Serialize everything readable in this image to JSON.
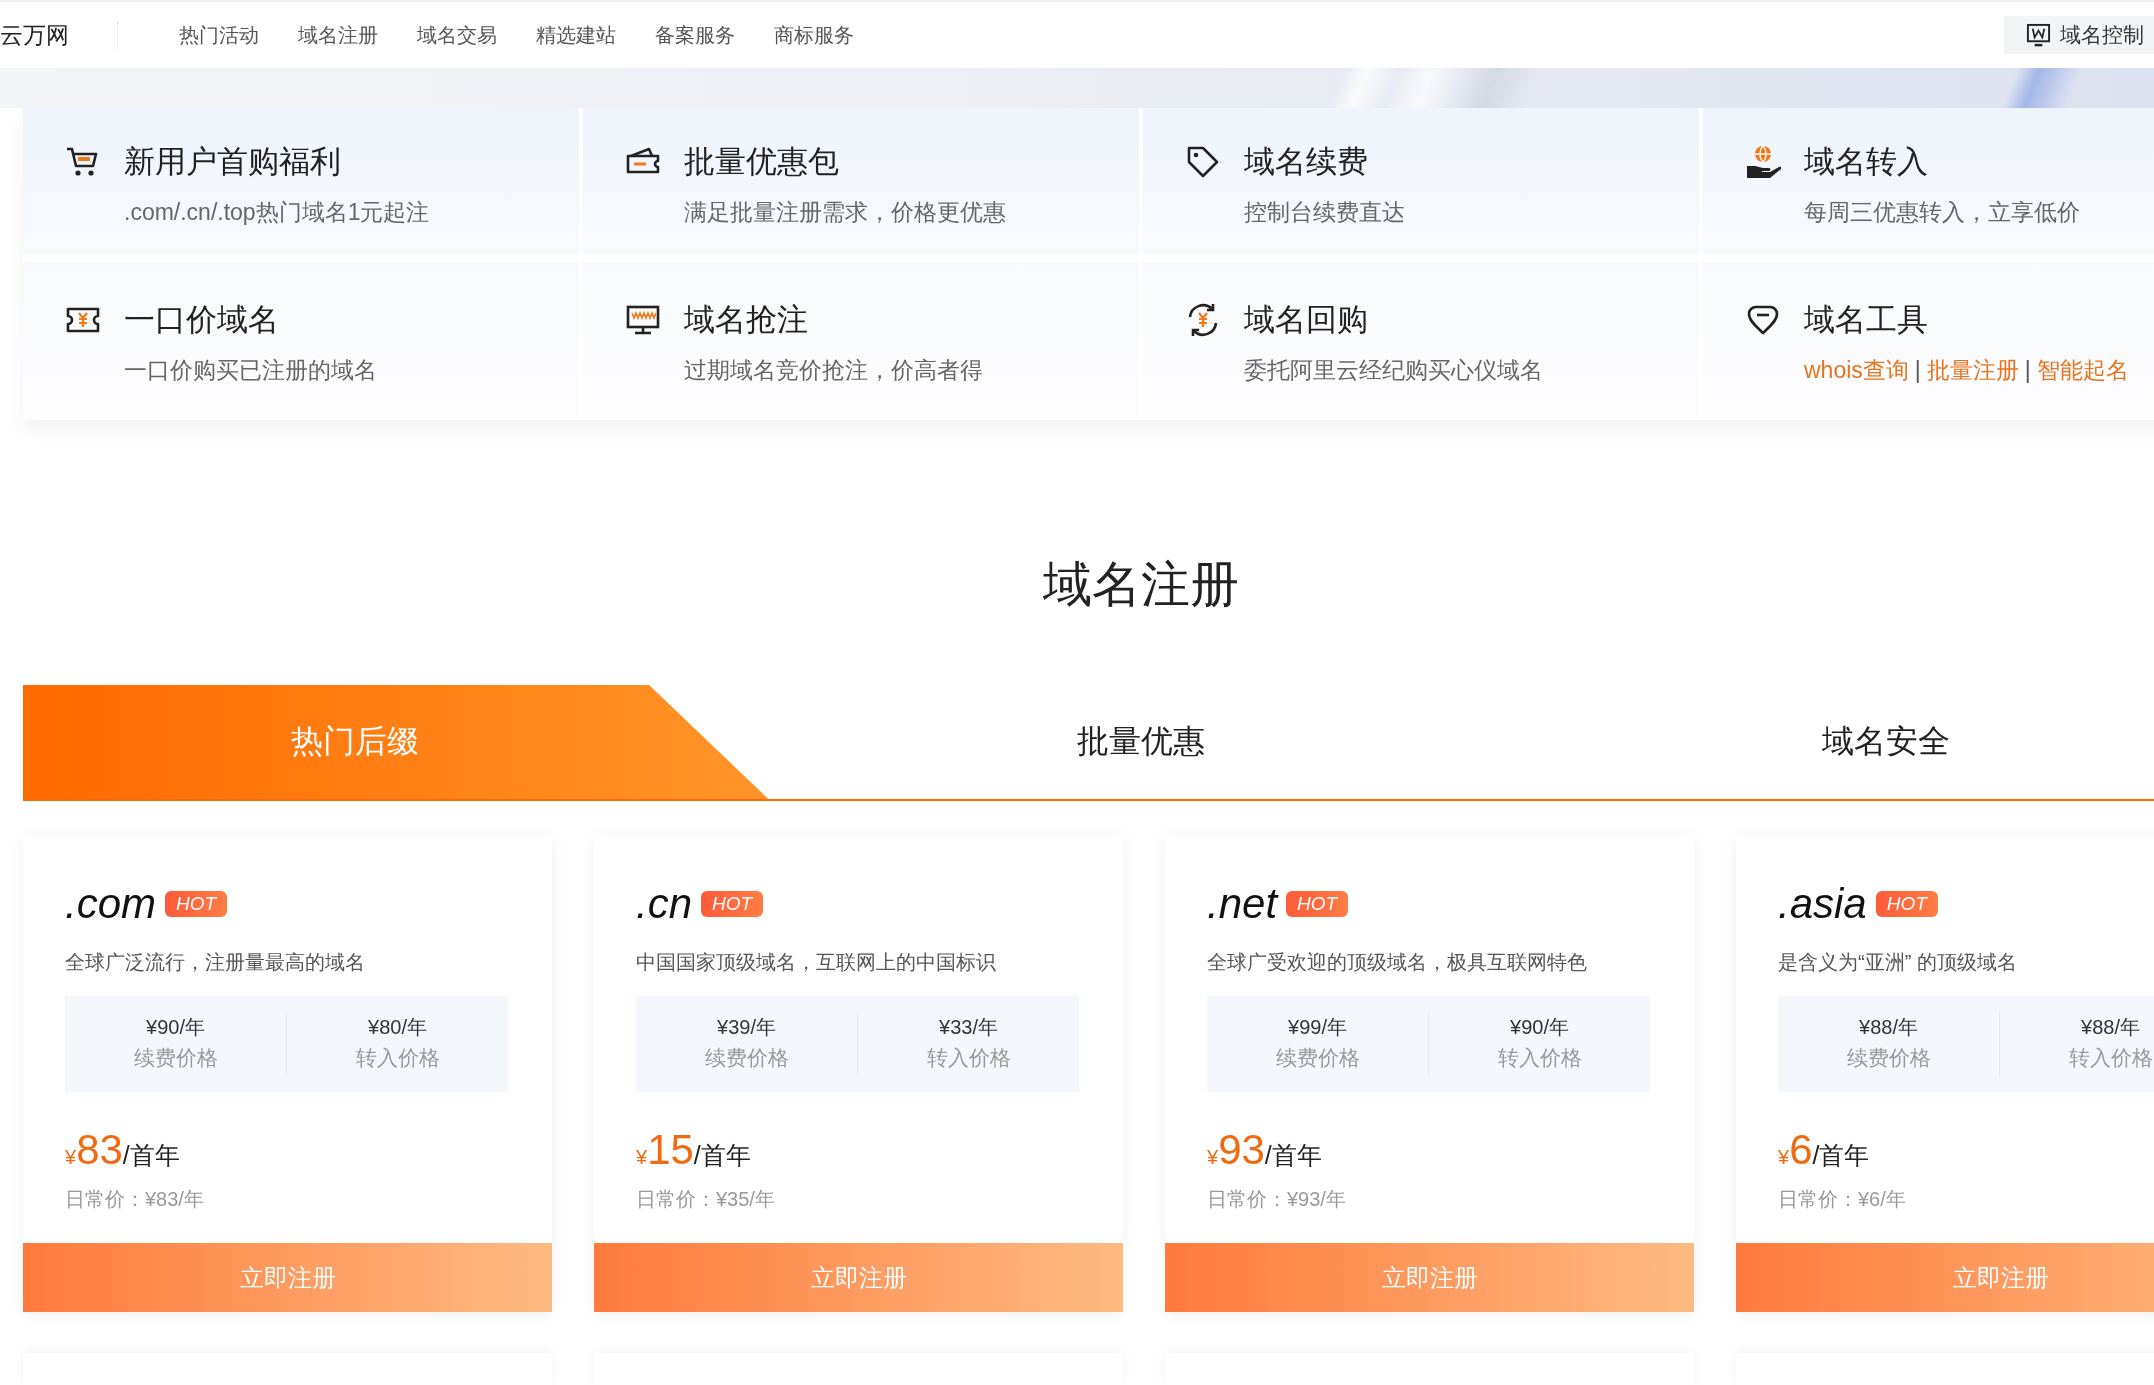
{
  "nav": {
    "logo": "云万网",
    "items": [
      "热门活动",
      "域名注册",
      "域名交易",
      "精选建站",
      "备案服务",
      "商标服务"
    ],
    "console_button": "域名控制"
  },
  "services": [
    {
      "kind": "text",
      "title": "新用户首购福利",
      "subtitle": ".com/.cn/.top热门域名1元起注"
    },
    {
      "kind": "text",
      "title": "批量优惠包",
      "subtitle": "满足批量注册需求，价格更优惠"
    },
    {
      "kind": "text",
      "title": "域名续费",
      "subtitle": "控制台续费直达"
    },
    {
      "kind": "text",
      "title": "域名转入",
      "subtitle": "每周三优惠转入，立享低价"
    },
    {
      "kind": "text",
      "title": "一口价域名",
      "subtitle": "一口价购买已注册的域名"
    },
    {
      "kind": "text",
      "title": "域名抢注",
      "subtitle": "过期域名竞价抢注，价高者得"
    },
    {
      "kind": "text",
      "title": "域名回购",
      "subtitle": "委托阿里云经纪购买心仪域名"
    },
    {
      "kind": "links",
      "title": "域名工具",
      "links": [
        "whois查询",
        "批量注册",
        "智能起名"
      ],
      "separator": "|"
    }
  ],
  "section": {
    "title": "域名注册",
    "tabs": [
      {
        "label": "热门后缀",
        "selected": true
      },
      {
        "label": "批量优惠",
        "selected": false
      },
      {
        "label": "域名安全",
        "selected": false
      }
    ]
  },
  "cards": [
    {
      "suffix": ".com",
      "badge": "HOT",
      "description": "全球广泛流行，注册量最高的域名",
      "prices": [
        {
          "amount": "¥90/年",
          "label": "续费价格"
        },
        {
          "amount": "¥80/年",
          "label": "转入价格"
        }
      ],
      "currency": "¥",
      "first_year_price": "83",
      "unit": "/首年",
      "regular_price": "日常价：¥83/年",
      "button": "立即注册"
    },
    {
      "suffix": ".cn",
      "badge": "HOT",
      "description": "中国国家顶级域名，互联网上的中国标识",
      "prices": [
        {
          "amount": "¥39/年",
          "label": "续费价格"
        },
        {
          "amount": "¥33/年",
          "label": "转入价格"
        }
      ],
      "currency": "¥",
      "first_year_price": "15",
      "unit": "/首年",
      "regular_price": "日常价：¥35/年",
      "button": "立即注册"
    },
    {
      "suffix": ".net",
      "badge": "HOT",
      "description": "全球广受欢迎的顶级域名，极具互联网特色",
      "prices": [
        {
          "amount": "¥99/年",
          "label": "续费价格"
        },
        {
          "amount": "¥90/年",
          "label": "转入价格"
        }
      ],
      "currency": "¥",
      "first_year_price": "93",
      "unit": "/首年",
      "regular_price": "日常价：¥93/年",
      "button": "立即注册"
    },
    {
      "suffix": ".asia",
      "badge": "HOT",
      "description": "是含义为“亚洲” 的顶级域名",
      "prices": [
        {
          "amount": "¥88/年",
          "label": "续费价格"
        },
        {
          "amount": "¥88/年",
          "label": "转入价格"
        }
      ],
      "currency": "¥",
      "first_year_price": "6",
      "unit": "/首年",
      "regular_price": "日常价：¥6/年",
      "button": "立即注册"
    }
  ]
}
